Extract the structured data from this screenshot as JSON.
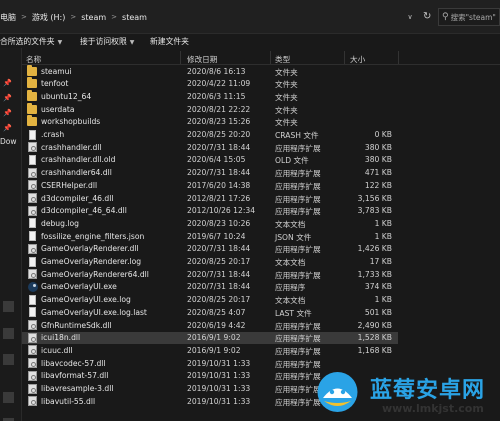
{
  "address": {
    "crumbs": [
      "电脑",
      "游戏 (H:)",
      "steam",
      "steam"
    ],
    "search_placeholder": "搜索\"steam\""
  },
  "commands": {
    "select_all": "合所选的文件夹",
    "sort_dropdown": "接于访问权限",
    "new_folder": "新建文件夹"
  },
  "navigation": {
    "partial_label": "Dow"
  },
  "columns": {
    "name": "名称",
    "date": "修改日期",
    "type": "类型",
    "size": "大小"
  },
  "files": [
    {
      "name": "steamui",
      "date": "2020/8/6 16:13",
      "type": "文件夹",
      "size": "",
      "icon": "folder-icon"
    },
    {
      "name": "tenfoot",
      "date": "2020/4/22 11:09",
      "type": "文件夹",
      "size": "",
      "icon": "folder-icon"
    },
    {
      "name": "ubuntu12_64",
      "date": "2020/6/3 11:15",
      "type": "文件夹",
      "size": "",
      "icon": "folder-icon"
    },
    {
      "name": "userdata",
      "date": "2020/8/21 22:22",
      "type": "文件夹",
      "size": "",
      "icon": "folder-icon"
    },
    {
      "name": "workshopbuilds",
      "date": "2020/8/23 15:26",
      "type": "文件夹",
      "size": "",
      "icon": "folder-icon"
    },
    {
      "name": ".crash",
      "date": "2020/8/25 20:20",
      "type": "CRASH 文件",
      "size": "0 KB",
      "icon": "file-icon"
    },
    {
      "name": "crashhandler.dll",
      "date": "2020/7/31 18:44",
      "type": "应用程序扩展",
      "size": "380 KB",
      "icon": "dll-icon"
    },
    {
      "name": "crashhandler.dll.old",
      "date": "2020/6/4 15:05",
      "type": "OLD 文件",
      "size": "380 KB",
      "icon": "file-icon"
    },
    {
      "name": "crashhandler64.dll",
      "date": "2020/7/31 18:44",
      "type": "应用程序扩展",
      "size": "471 KB",
      "icon": "dll-icon"
    },
    {
      "name": "CSERHelper.dll",
      "date": "2017/6/20 14:38",
      "type": "应用程序扩展",
      "size": "122 KB",
      "icon": "dll-icon"
    },
    {
      "name": "d3dcompiler_46.dll",
      "date": "2012/8/21 17:26",
      "type": "应用程序扩展",
      "size": "3,156 KB",
      "icon": "dll-icon"
    },
    {
      "name": "d3dcompiler_46_64.dll",
      "date": "2012/10/26 12:34",
      "type": "应用程序扩展",
      "size": "3,783 KB",
      "icon": "dll-icon"
    },
    {
      "name": "debug.log",
      "date": "2020/8/23 10:26",
      "type": "文本文档",
      "size": "1 KB",
      "icon": "file-icon"
    },
    {
      "name": "fossilize_engine_filters.json",
      "date": "2019/6/7 10:24",
      "type": "JSON 文件",
      "size": "1 KB",
      "icon": "file-icon"
    },
    {
      "name": "GameOverlayRenderer.dll",
      "date": "2020/7/31 18:44",
      "type": "应用程序扩展",
      "size": "1,426 KB",
      "icon": "dll-icon"
    },
    {
      "name": "GameOverlayRenderer.log",
      "date": "2020/8/25 20:17",
      "type": "文本文档",
      "size": "17 KB",
      "icon": "file-icon"
    },
    {
      "name": "GameOverlayRenderer64.dll",
      "date": "2020/7/31 18:44",
      "type": "应用程序扩展",
      "size": "1,733 KB",
      "icon": "dll-icon"
    },
    {
      "name": "GameOverlayUI.exe",
      "date": "2020/7/31 18:44",
      "type": "应用程序",
      "size": "374 KB",
      "icon": "steam-icon"
    },
    {
      "name": "GameOverlayUI.exe.log",
      "date": "2020/8/25 20:17",
      "type": "文本文档",
      "size": "1 KB",
      "icon": "file-icon"
    },
    {
      "name": "GameOverlayUI.exe.log.last",
      "date": "2020/8/25 4:07",
      "type": "LAST 文件",
      "size": "501 KB",
      "icon": "file-icon"
    },
    {
      "name": "GfnRuntimeSdk.dll",
      "date": "2020/6/19 4:42",
      "type": "应用程序扩展",
      "size": "2,490 KB",
      "icon": "dll-icon"
    },
    {
      "name": "icui18n.dll",
      "date": "2016/9/1 9:02",
      "type": "应用程序扩展",
      "size": "1,528 KB",
      "icon": "dll-icon",
      "selected": true
    },
    {
      "name": "icuuc.dll",
      "date": "2016/9/1 9:02",
      "type": "应用程序扩展",
      "size": "1,168 KB",
      "icon": "dll-icon"
    },
    {
      "name": "libavcodec-57.dll",
      "date": "2019/10/31 1:33",
      "type": "应用程序扩展",
      "size": "",
      "icon": "dll-icon"
    },
    {
      "name": "libavformat-57.dll",
      "date": "2019/10/31 1:33",
      "type": "应用程序扩展",
      "size": "",
      "icon": "dll-icon"
    },
    {
      "name": "libavresample-3.dll",
      "date": "2019/10/31 1:33",
      "type": "应用程序扩展",
      "size": "",
      "icon": "dll-icon"
    },
    {
      "name": "libavutil-55.dll",
      "date": "2019/10/31 1:33",
      "type": "应用程序扩展",
      "size": "",
      "icon": "dll-icon"
    }
  ],
  "watermark": {
    "title": "蓝莓安卓网",
    "url": "www.lmkjst.com",
    "color": "#2aa3e6"
  }
}
